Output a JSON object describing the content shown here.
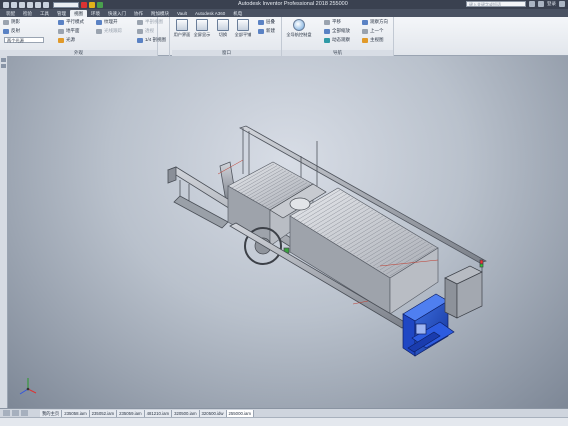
{
  "titlebar": {
    "app_title": "Autodesk Inventor Professional 2018   255000",
    "search_placeholder": "键入关键字或短语",
    "login": "登录"
  },
  "tabs": [
    "装配",
    "检验",
    "工具",
    "管理",
    "视图",
    "环境",
    "快速入门",
    "协作",
    "附加模块",
    "Vault",
    "Autodesk A360",
    "机电"
  ],
  "active_tab_index": 4,
  "ribbon": {
    "appearance_panel": {
      "title": "外观",
      "items": [
        "阴影",
        "反射",
        "平行模式",
        "地平面",
        "光源",
        "纹理开",
        "光线跟踪"
      ],
      "dropdown": "两个光源"
    },
    "view_panel": {
      "items": [
        "半剖视图",
        "透视",
        "1/4 剖视图"
      ]
    },
    "window_panel": {
      "title": "窗口",
      "buttons": [
        "用户界面",
        "全屏显示",
        "切换",
        "全部平铺",
        "层叠",
        "新建"
      ]
    },
    "nav_panel": {
      "title": "导航",
      "buttons": [
        "全导航控制盘"
      ],
      "items": [
        "平移",
        "全部缩放",
        "动态观察",
        "观察方向",
        "上一个",
        "主视图"
      ]
    }
  },
  "doc_tabs": [
    "我的主页",
    "235058.iam",
    "235052.iam",
    "235059.iam",
    "481210.iam",
    "320500.iam",
    "320500.idw",
    "255000.iam"
  ],
  "active_doc_index": 7
}
